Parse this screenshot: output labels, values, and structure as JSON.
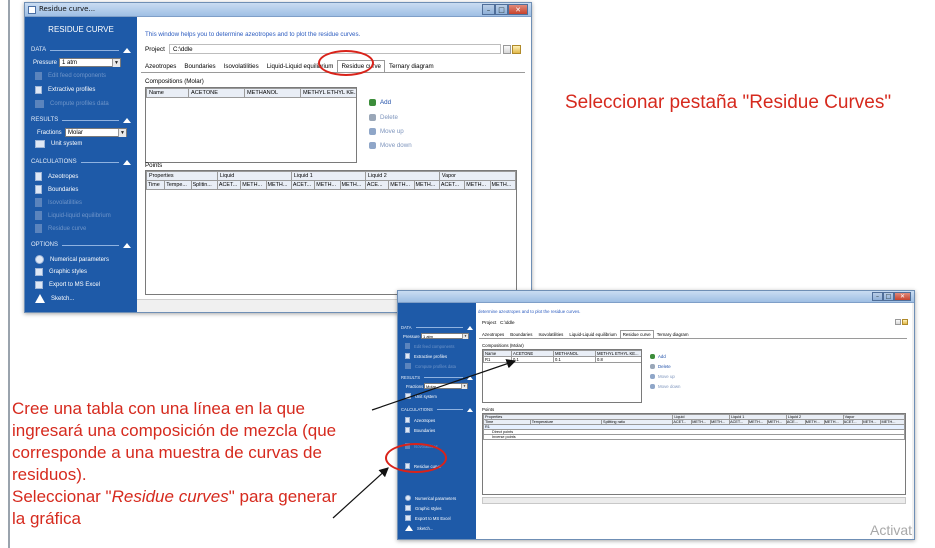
{
  "slide": {
    "caption_top": "Seleccionar pestaña \"Residue Curves\"",
    "caption_bottom": [
      "Cree una tabla con una línea en la que",
      "ingresará una composición de mezcla (que",
      "corresponde a una muestra de curvas de",
      "residuos)."
    ],
    "caption_select_prefix": "Seleccionar \"",
    "caption_select_em": "Residue curves",
    "caption_select_suffix": "\" para generar",
    "caption_select_line2": "la gráfica",
    "watermark": "Activat",
    "colors": {
      "annotation_red": "#d62a1e",
      "sidebar_blue": "#1e5aa8",
      "info_blue": "#2b5bbf"
    }
  },
  "win1": {
    "title": "Residue curve...",
    "sidebar": {
      "header": "RESIDUE CURVE",
      "data_section": "DATA",
      "pressure_label": "Pressure",
      "pressure_value": "1 atm",
      "dis_item_1": "Edit feed components",
      "extractive_profiles": "Extractive profiles",
      "dis_item_2": "Compute profiles data",
      "results_section": "RESULTS",
      "fractions_label": "Fractions",
      "fractions_value": "Molar",
      "unit_system": "Unit system",
      "calculations_section": "CALCULATIONS",
      "azeotropes": "Azeotropes",
      "boundaries": "Boundaries",
      "dis_calc_1": "Isovolatilities",
      "dis_calc_2": "Liquid-liquid equilibrium",
      "dis_calc_3": "Residue curve",
      "options_section": "OPTIONS",
      "numerical_parameters": "Numerical parameters",
      "graphic_styles": "Graphic styles",
      "export_excel": "Export to MS Excel",
      "sketch": "Sketch..."
    },
    "info": "This window helps you to determine azeotropes and to plot the residue curves.",
    "project_label": "Project",
    "project_value": "C:\\ddle",
    "tabs": [
      "Azeotropes",
      "Boundaries",
      "Isovolatilities",
      "Liquid-Liquid equilibrium",
      "Residue curve",
      "Ternary diagram"
    ],
    "compositions_title": "Compositions (Molar)",
    "comp_headers": [
      "Name",
      "ACETONE",
      "METHANOL",
      "METHYL ETHYL KE..."
    ],
    "actions": {
      "add": "Add",
      "delete": "Delete",
      "move_up": "Move up",
      "move_down": "Move down"
    },
    "points_title": "Points",
    "points_group_row": [
      "Properties",
      "Liquid",
      "Liquid 1",
      "Liquid 2",
      "Vapor"
    ],
    "points_sub_row": [
      "Time",
      "Tempe...",
      "Splitin...",
      "ACET...",
      "METH...",
      "METH...",
      "ACET...",
      "METH...",
      "METH...",
      "ACE...",
      "METH...",
      "METH...",
      "ACET...",
      "METH...",
      "METH..."
    ]
  },
  "win2": {
    "info": "determine azeotropes and to plot the residue curves.",
    "sidebar": {
      "data_section": "DATA",
      "pressure_label": "Pressure",
      "pressure_value": "1 atm",
      "dis_item_1": "Edit feed components",
      "extractive_profiles": "Extractive profiles",
      "dis_item_2": "Compute profiles data",
      "results_section": "RESULTS",
      "fractions_label": "Fractions",
      "fractions_value": "Molar",
      "unit_system": "Unit system",
      "calculations_section": "CALCULATIONS",
      "azeotropes": "Azeotropes",
      "boundaries": "Boundaries",
      "dis_calc_1": "Isovolatilities",
      "residue_curve": "Residue curve",
      "numerical_parameters": "Numerical parameters",
      "graphic_styles": "Graphic styles",
      "export_excel": "Export to MS Excel",
      "sketch": "Sketch..."
    },
    "project_label": "Project",
    "project_value": "C:\\ddle",
    "tabs": [
      "Azeotropes",
      "Boundaries",
      "Isovolatilities",
      "Liquid-Liquid equilibrium",
      "Residue curve",
      "Ternary diagram"
    ],
    "compositions_title": "Compositions (Molar)",
    "comp_headers": [
      "Name",
      "ACETONE",
      "METHANOL",
      "METHYL ETHYL KE..."
    ],
    "comp_row": [
      "R1",
      "0.1",
      "0.1",
      "0.8"
    ],
    "actions": {
      "add": "Add",
      "delete": "Delete",
      "move_up": "Move up",
      "move_down": "Move down"
    },
    "points_title": "Points",
    "points_group_row": [
      "Properties",
      "Liquid",
      "Liquid 1",
      "Liquid 2",
      "Vapor"
    ],
    "points_sub_row": [
      "Time",
      "Temperature",
      "Splitting ratio",
      "ACET...",
      "METH...",
      "METH...",
      "ACET...",
      "METH...",
      "METH...",
      "ACE...",
      "METH...",
      "METH...",
      "ACET...",
      "METH...",
      "METH..."
    ],
    "points_rows": [
      "R1",
      "Direct points",
      "Inverse points"
    ]
  }
}
